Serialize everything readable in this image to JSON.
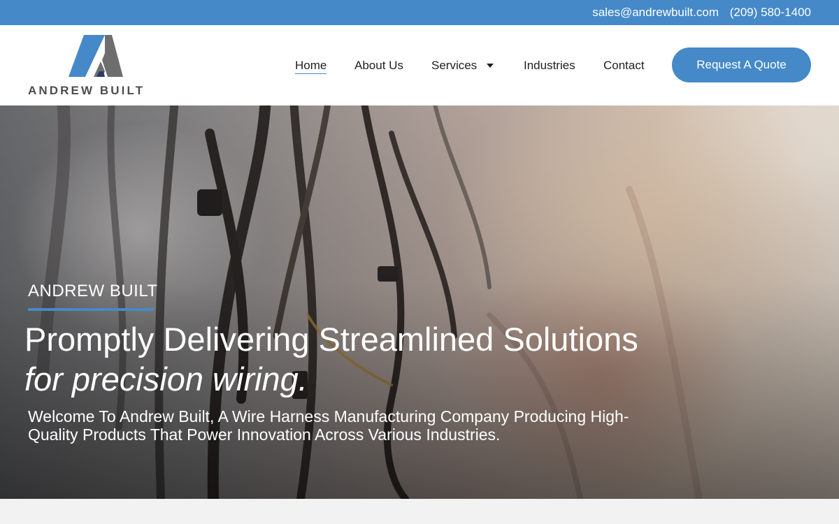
{
  "topbar": {
    "email": "sales@andrewbuilt.com",
    "phone": "(209) 580-1400"
  },
  "logo": {
    "text": "ANDREW BUILT",
    "colors": {
      "blue": "#4589c9",
      "gray": "#6e6e6e",
      "navy": "#2b3a67"
    }
  },
  "nav": {
    "home": "Home",
    "about": "About Us",
    "services": "Services",
    "industries": "Industries",
    "contact": "Contact"
  },
  "cta": {
    "label": "Request A Quote"
  },
  "hero": {
    "eyebrow": "ANDREW BUILT",
    "headline_line1": "Promptly Delivering Streamlined Solutions",
    "headline_line2": "for precision wiring.",
    "subtext": "Welcome To Andrew Built, A Wire Harness Manufacturing Company Producing High-Quality Products That Power Innovation Across Various Industries."
  },
  "icons": {
    "services_dropdown": "caret-down-icon"
  },
  "colors": {
    "accent": "#4589c9",
    "nav_text": "#1f1f1f",
    "page_bg": "#f2f2f2"
  }
}
